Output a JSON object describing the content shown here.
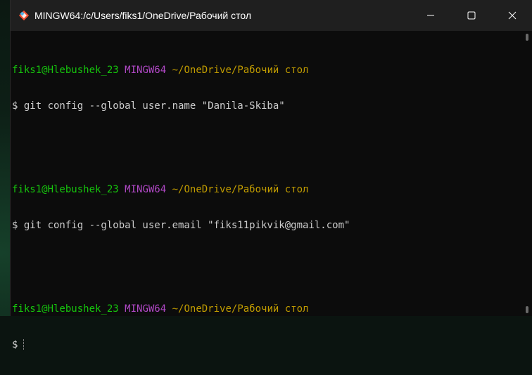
{
  "window": {
    "title": "MINGW64:/c/Users/fiks1/OneDrive/Рабочий стол"
  },
  "icons": {
    "app": "git-diamond-icon",
    "minimize": "minimize-icon",
    "maximize": "maximize-icon",
    "close": "close-icon"
  },
  "colors": {
    "user_host": "#16c60c",
    "system": "#b148c6",
    "path": "#c19c00",
    "text": "#cccccc",
    "background": "#0c0c0c"
  },
  "terminal": {
    "blocks": [
      {
        "user_host": "fiks1@Hlebushek_23",
        "system": "MINGW64",
        "path": "~/OneDrive/Рабочий стол",
        "command": "$ git config --global user.name \"Danila-Skiba\""
      },
      {
        "user_host": "fiks1@Hlebushek_23",
        "system": "MINGW64",
        "path": "~/OneDrive/Рабочий стол",
        "command": "$ git config --global user.email \"fiks11pikvik@gmail.com\""
      },
      {
        "user_host": "fiks1@Hlebushek_23",
        "system": "MINGW64",
        "path": "~/OneDrive/Рабочий стол",
        "command": "$"
      }
    ]
  }
}
